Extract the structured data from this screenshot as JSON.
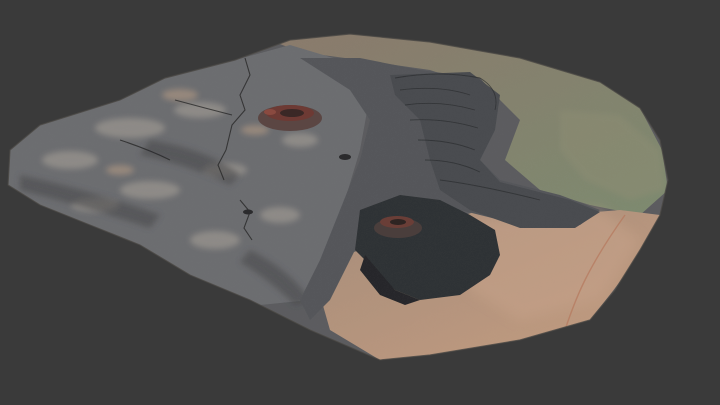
{
  "viewer": {
    "background_color": "#3a3a3a"
  },
  "model": {
    "subject": "terrain-lava-field",
    "features": [
      "lava-flow",
      "crater-cone-upper",
      "crater-cone-lower",
      "small-vent",
      "desert-plain",
      "ridge-slope"
    ],
    "palette": {
      "basalt_dark": "#3f4043",
      "basalt_mid": "#5e6063",
      "basalt_light": "#8a8b8d",
      "flow_fresh": "#2f3033",
      "desert_tan": "#b4927a",
      "ridge_brown": "#8f7c6b",
      "cone_red": "#6d3a34"
    }
  }
}
